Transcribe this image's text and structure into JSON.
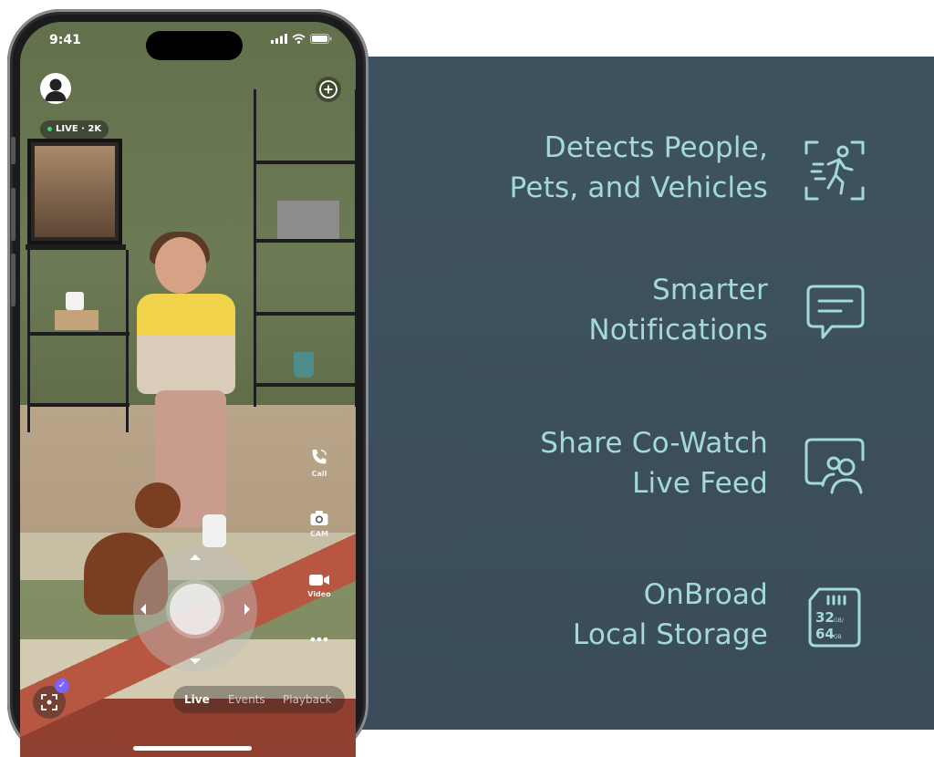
{
  "phone": {
    "status": {
      "time": "9:41"
    },
    "live_badge": "LIVE · 2K",
    "rail": [
      {
        "label": "Call",
        "icon": "phone-call-icon"
      },
      {
        "label": "CAM",
        "icon": "camera-icon"
      },
      {
        "label": "Video",
        "icon": "video-icon"
      },
      {
        "label": "",
        "icon": "more-icon"
      }
    ],
    "scan_badge": "✓",
    "tabs": [
      {
        "label": "Live",
        "active": true
      },
      {
        "label": "Events",
        "active": false
      },
      {
        "label": "Playback",
        "active": false
      }
    ]
  },
  "features": [
    {
      "lines": [
        "Detects People,",
        "Pets, and Vehicles"
      ],
      "icon": "person-detection-icon"
    },
    {
      "lines": [
        "Smarter",
        "Notifications"
      ],
      "icon": "chat-notification-icon"
    },
    {
      "lines": [
        "Share Co-Watch",
        "Live Feed"
      ],
      "icon": "shared-user-icon"
    },
    {
      "lines": [
        "OnBroad",
        "Local Storage"
      ],
      "icon": "sd-card-icon",
      "sd_card": {
        "size_top": "32",
        "unit_top": "GB/",
        "size_bottom": "64",
        "unit_bottom": "GB"
      }
    }
  ],
  "colors": {
    "panel": "#3f5260",
    "accent_text": "#a3dad6",
    "purple_badge": "#7b63ff"
  }
}
